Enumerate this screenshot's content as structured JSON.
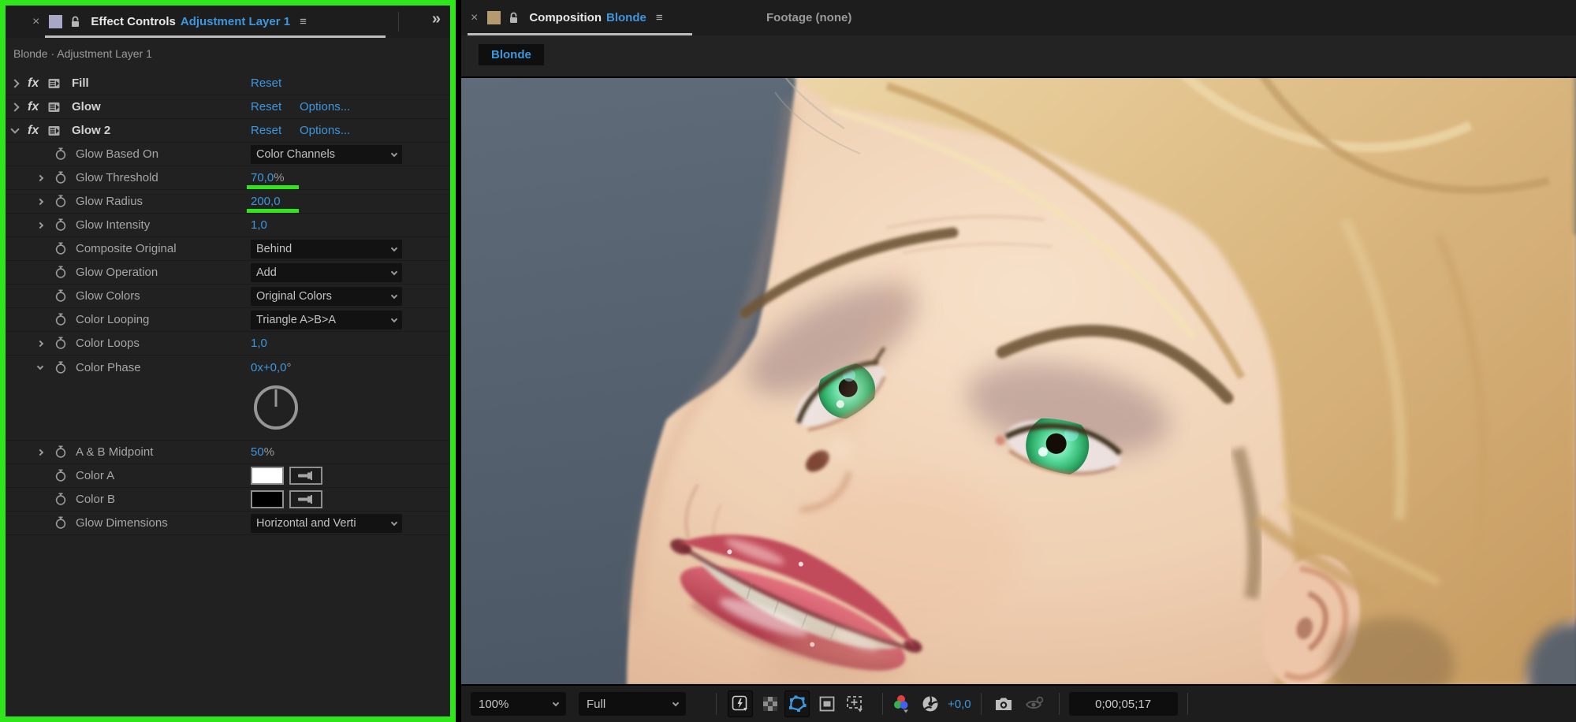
{
  "annotation": {
    "color": "#2ee619"
  },
  "effect_controls": {
    "tab": {
      "close": "×",
      "swatch_color": "#a8a8c6",
      "title": "Effect Controls",
      "target": "Adjustment Layer 1",
      "menu": "≡"
    },
    "expand": "»",
    "subtitle": "Blonde · Adjustment Layer 1",
    "rows": [
      {
        "name": "Fill",
        "reset": "Reset"
      },
      {
        "name": "Glow",
        "reset": "Reset",
        "options": "Options..."
      },
      {
        "name": "Glow 2",
        "reset": "Reset",
        "options": "Options..."
      },
      {
        "label": "Glow Based On",
        "value": "Color Channels"
      },
      {
        "label": "Glow Threshold",
        "value": "70,0",
        "suffix": "%"
      },
      {
        "label": "Glow Radius",
        "value": "200,0"
      },
      {
        "label": "Glow Intensity",
        "value": "1,0"
      },
      {
        "label": "Composite Original",
        "value": "Behind"
      },
      {
        "label": "Glow Operation",
        "value": "Add"
      },
      {
        "label": "Glow Colors",
        "value": "Original Colors"
      },
      {
        "label": "Color Looping",
        "value": "Triangle A>B>A"
      },
      {
        "label": "Color Loops",
        "value": "1,0"
      },
      {
        "label": "Color Phase",
        "value": "0x+0,0",
        "suffix": "°"
      },
      {
        "label": "A & B Midpoint",
        "value": "50",
        "suffix": "%"
      },
      {
        "label": "Color A",
        "swatch": "#ffffff"
      },
      {
        "label": "Color B",
        "swatch": "#000000"
      },
      {
        "label": "Glow Dimensions",
        "value": "Horizontal and Verti"
      }
    ]
  },
  "composition": {
    "tab": {
      "close": "×",
      "swatch_color": "#b49a6e",
      "title": "Composition",
      "target": "Blonde",
      "menu": "≡"
    },
    "footage_tab": "Footage (none)",
    "breadcrumb": "Blonde",
    "toolbar": {
      "zoom": "100%",
      "resolution": "Full",
      "exposure": "+0,0",
      "timecode": "0;00;05;17",
      "icons": [
        "fast-previews",
        "transparency-grid",
        "mask-visibility",
        "region-of-interest",
        "grid-guides",
        "channel-color",
        "exposure-reset",
        "snapshot",
        "show-snapshot"
      ]
    }
  }
}
